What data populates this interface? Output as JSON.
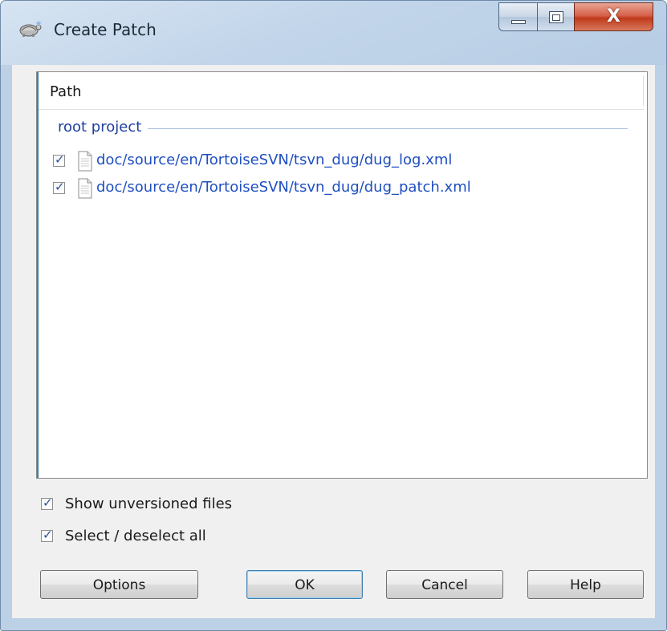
{
  "window": {
    "title": "Create Patch",
    "close_glyph": "X"
  },
  "list": {
    "column_header": "Path",
    "group_label": "root project",
    "items": [
      {
        "path": "doc/source/en/TortoiseSVN/tsvn_dug/dug_log.xml",
        "checked": true
      },
      {
        "path": "doc/source/en/TortoiseSVN/tsvn_dug/dug_patch.xml",
        "checked": true
      }
    ]
  },
  "options": {
    "show_unversioned": {
      "label": "Show unversioned files",
      "checked": true
    },
    "select_all": {
      "label": "Select / deselect all",
      "checked": true
    }
  },
  "buttons": {
    "options": "Options",
    "ok": "OK",
    "cancel": "Cancel",
    "help": "Help"
  },
  "icons": {
    "app": "tortoise-icon",
    "file": "document-icon",
    "check": "checkmark-icon"
  },
  "colors": {
    "link_text": "#1f4fc0",
    "group_text": "#1e3f9f",
    "close_button": "#c0391c"
  }
}
